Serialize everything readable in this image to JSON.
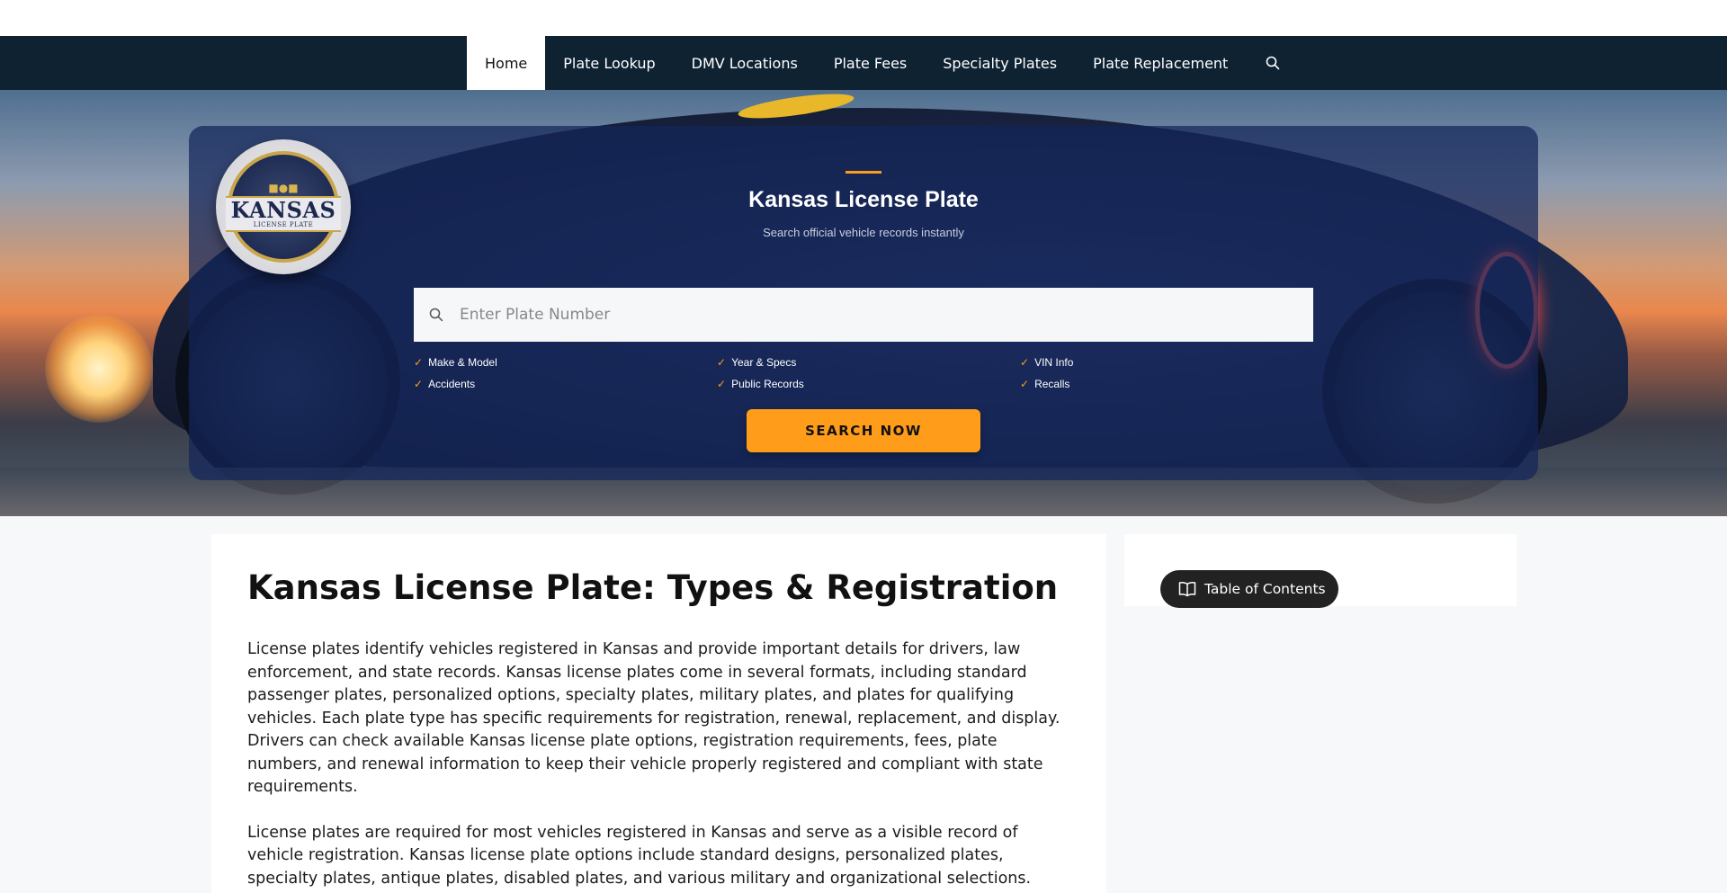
{
  "nav": {
    "items": [
      {
        "label": "Home",
        "active": true
      },
      {
        "label": "Plate Lookup"
      },
      {
        "label": "DMV Locations"
      },
      {
        "label": "Plate Fees"
      },
      {
        "label": "Specialty Plates"
      },
      {
        "label": "Plate Replacement"
      }
    ],
    "search_icon": "search-icon"
  },
  "hero": {
    "logo": {
      "title": "KANSAS",
      "subtitle": "LICENSE PLATE"
    },
    "title": "Kansas License Plate",
    "subtitle": "Search official vehicle records instantly",
    "search": {
      "placeholder": "Enter Plate Number",
      "value": ""
    },
    "features": [
      "Make & Model",
      "Year & Specs",
      "VIN Info",
      "Accidents",
      "Public Records",
      "Recalls"
    ],
    "button_label": "SEARCH NOW"
  },
  "article": {
    "title": "Kansas License Plate: Types & Registration",
    "paragraphs": [
      "License plates identify vehicles registered in Kansas and provide important details for drivers, law enforcement, and state records. Kansas license plates come in several formats, including standard passenger plates, personalized options, specialty plates, military plates, and plates for qualifying vehicles. Each plate type has specific requirements for registration, renewal, replacement, and display. Drivers can check available Kansas license plate options, registration requirements, fees, plate numbers, and renewal information to keep their vehicle properly registered and compliant with state requirements.",
      "License plates are required for most vehicles registered in Kansas and serve as a visible record of vehicle registration. Kansas license plate options include standard designs, personalized plates, specialty plates, antique plates, disabled plates, and various military and organizational selections. Plate owners may need to follow specific rules for applications, renewals, replacements, fees, and proper display. Knowing the"
    ]
  },
  "sidebar": {
    "toc_label": "Table of Contents",
    "toc_icon": "book-icon"
  },
  "colors": {
    "nav_bg": "#0f2232",
    "accent": "#ff9d1a",
    "hero_card": "#14265a"
  }
}
